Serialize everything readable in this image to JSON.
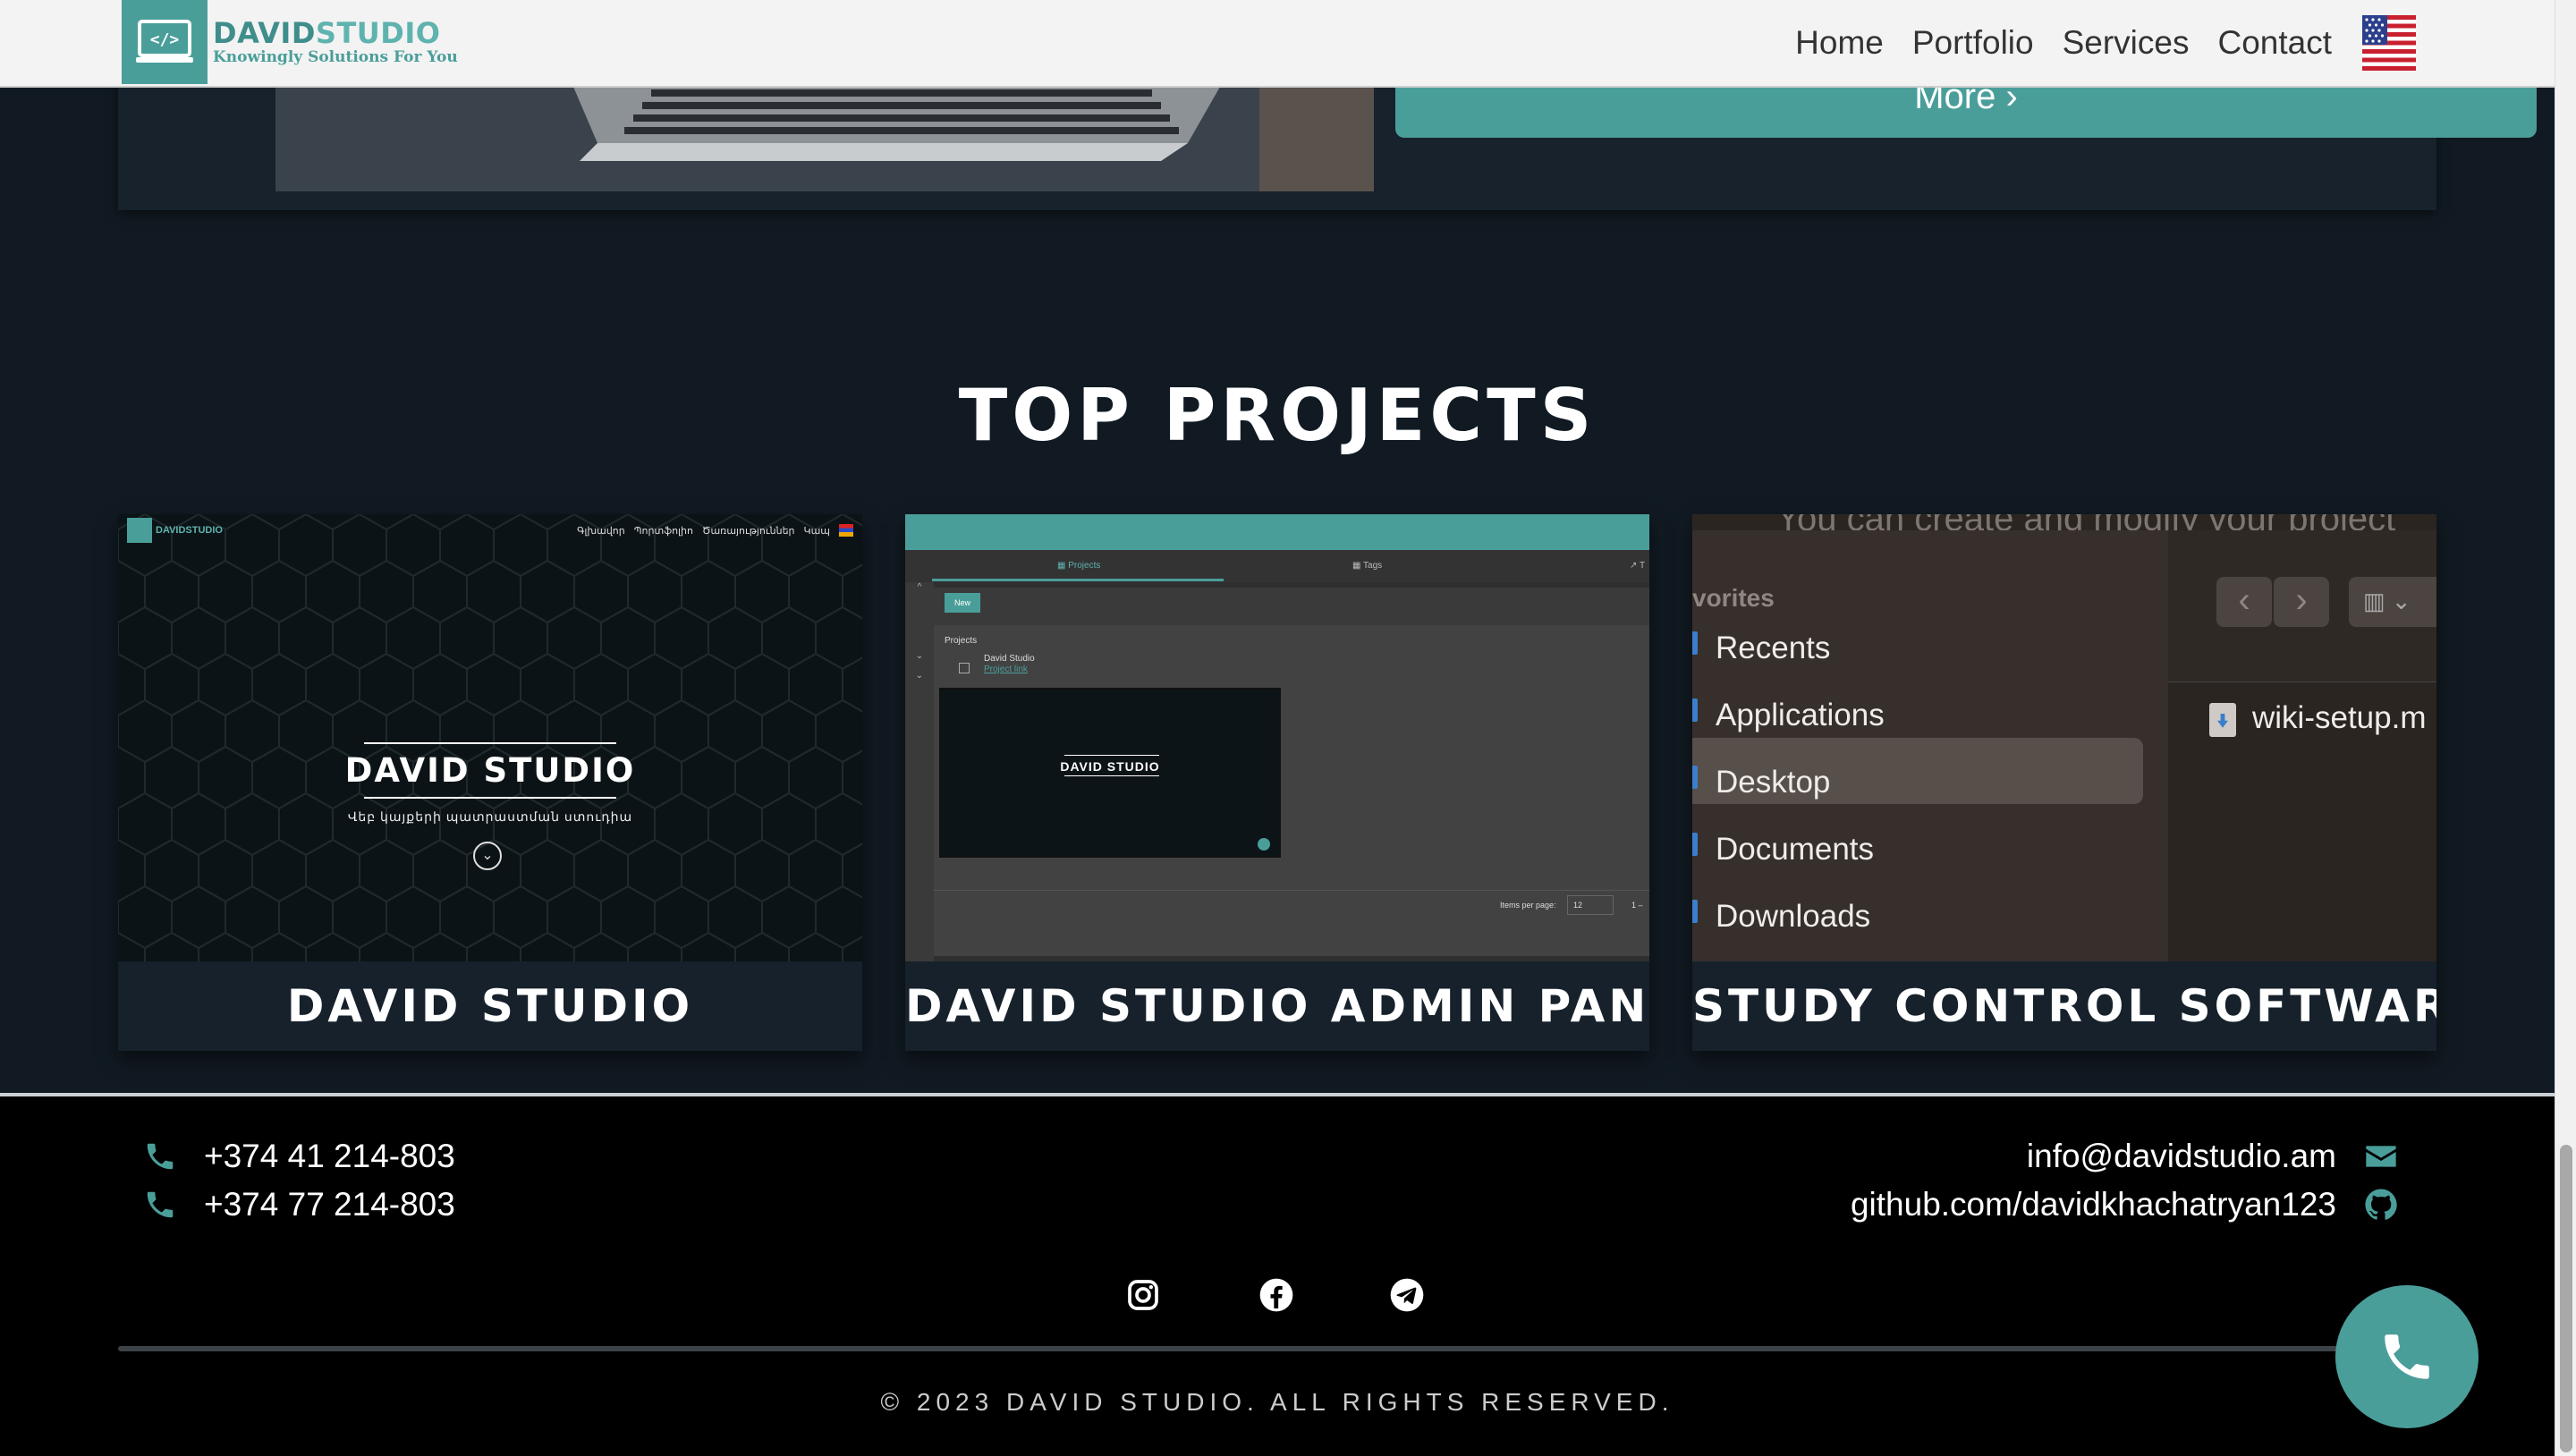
{
  "header": {
    "logo_name_part1": "DAVID",
    "logo_name_part2": "STUDIO",
    "logo_tagline": "Knowingly Solutions For You",
    "nav": [
      "Home",
      "Portfolio",
      "Services",
      "Contact"
    ],
    "language_icon": "us-flag-icon"
  },
  "hero": {
    "more_button_label": "More ›"
  },
  "projects": {
    "section_title": "TOP PROJECTS",
    "items": [
      {
        "title": "DAVID STUDIO",
        "thumb": {
          "logo_text": "DAVIDSTUDIO",
          "nav": [
            "Գլխավոր",
            "Պորտֆոլիո",
            "Ծառայություններ",
            "Կապ"
          ],
          "headline": "DAVID STUDIO",
          "subline": "Վեբ կայքերի պատրաստման ստուդիա",
          "down_icon": "⌄"
        }
      },
      {
        "title": "DAVID STUDIO ADMIN PANEL",
        "thumb": {
          "tab1": "▦ Projects",
          "tab2": "▦ Tags",
          "tab3": "↗ T",
          "new_button": "New",
          "panel_title": "Projects",
          "project_name": "David Studio",
          "project_link": "Project link",
          "mini_title": "DAVID STUDIO",
          "items_per_page_label": "Items per page:",
          "items_per_page_value": "12",
          "paging": "1 –"
        }
      },
      {
        "title": "STUDY CONTROL SOFTWARE",
        "thumb": {
          "top_text": "You can create and modify your project",
          "favorites_label": "vorites",
          "sidebar_items": [
            "Recents",
            "Applications",
            "Desktop",
            "Documents",
            "Downloads"
          ],
          "selected_item": "Desktop",
          "file_name": "wiki-setup.m"
        }
      }
    ]
  },
  "footer": {
    "phones": [
      "+374 41 214-803",
      "+374 77 214-803"
    ],
    "email": "info@davidstudio.am",
    "github": "github.com/davidkhachatryan123",
    "social_icons": [
      "instagram-icon",
      "facebook-icon",
      "telegram-icon"
    ],
    "copyright": "© 2023 DAVID STUDIO. ALL RIGHTS RESERVED."
  },
  "colors": {
    "accent": "#4a9e9a",
    "background": "#111a22",
    "footer_bg": "#000000",
    "header_bg": "#f3f3f3"
  }
}
